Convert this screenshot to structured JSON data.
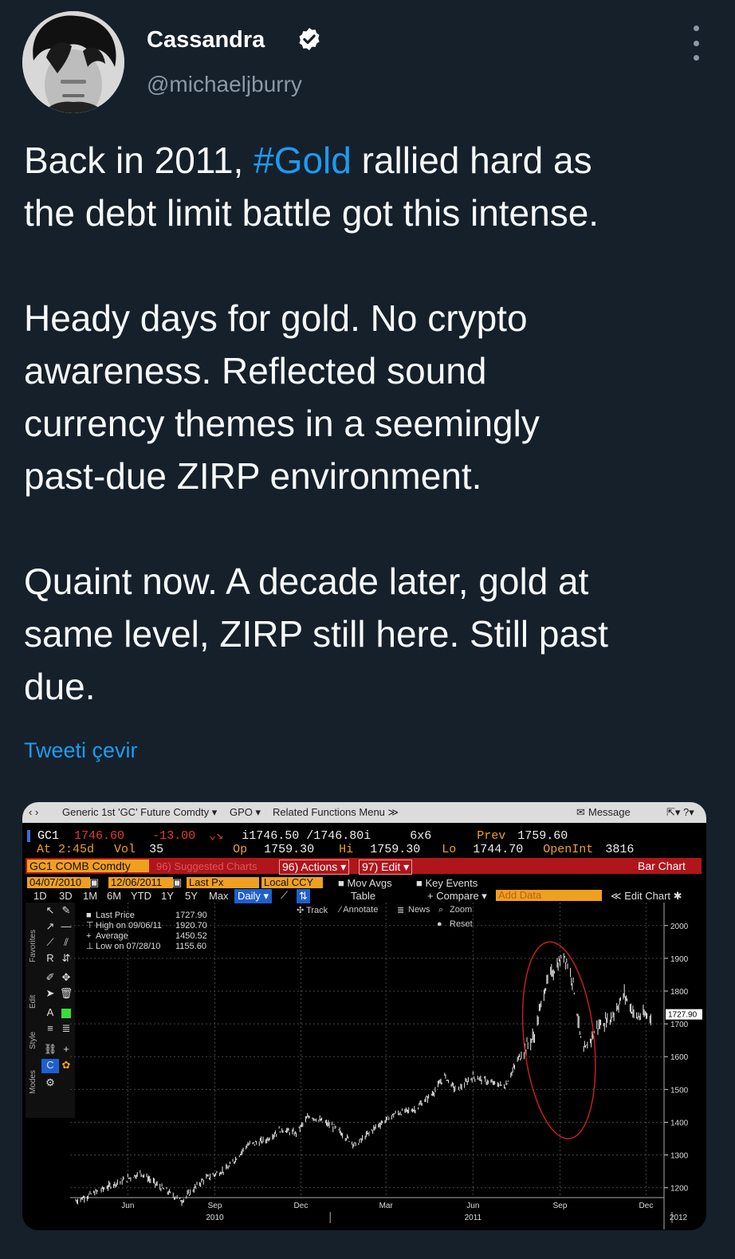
{
  "author": {
    "name": "Cassandra",
    "handle": "@michaeljburry",
    "verified": true,
    "avatar": "avatar-photo"
  },
  "more_icon": "more-vertical-icon",
  "tweet": {
    "para1_before": "Back in 2011, ",
    "hashtag": "#Gold",
    "para1_after": " rallied hard as\nthe debt limit battle got this intense.",
    "para2": "Heady days for gold. No crypto\nawareness. Reflected sound\ncurrency themes in a seemingly\npast-due ZIRP environment.",
    "para3": "Quaint now. A decade later, gold at\nsame level, ZIRP still here. Still past\ndue."
  },
  "translate_link": "Tweeti çevir",
  "colors": {
    "background": "#15202b",
    "link": "#1d9bf0",
    "secondary": "#8b98a5",
    "bloomberg_orange": "#f0a020",
    "bloomberg_red": "#b0151b"
  },
  "terminal": {
    "menubar": {
      "nav": "‹  ›",
      "generic": "Generic 1st 'GC' Future Comdty ▾",
      "gpo": "GPO ▾",
      "related": "Related Functions Menu ≫",
      "message": "Message",
      "right_icons": "⇱▾ ?▾"
    },
    "quote": {
      "ticker": "GC1",
      "last": "1746.60",
      "change": "-13.00",
      "bidask": "i1746.50 /1746.80i",
      "size": "6x6",
      "prev_label": "Prev",
      "prev": "1759.60",
      "at": "At 2:45d",
      "vol_label": "Vol",
      "vol": "35",
      "op_label": "Op",
      "op": "1759.30",
      "hi_label": "Hi",
      "hi": "1759.30",
      "lo_label": "Lo",
      "lo": "1744.70",
      "oi_label": "OpenInt",
      "oi": "3816"
    },
    "security": "GC1 COMB Comdty",
    "suggested": "96) Suggested Charts",
    "actions": "96) Actions ▾",
    "edit": "97) Edit ▾",
    "chart_type": "Bar Chart",
    "date_from": "04/07/2010",
    "date_to": "12/06/2011",
    "field": "Last Px",
    "currency": "Local CCY",
    "mov_avgs": "Mov Avgs",
    "key_events": "Key Events",
    "add_data": "Add Data",
    "periods": [
      "1D",
      "3D",
      "1M",
      "6M",
      "YTD",
      "1Y",
      "5Y",
      "Max"
    ],
    "frequency": "Daily ▾",
    "table": "Table",
    "compare": "+ Compare ▾",
    "edit_chart": "≪  Edit Chart  ✱",
    "chart_tools": {
      "track": "✣ Track",
      "annotate": "⁄ Annotate",
      "news": "News",
      "zoom": "Zoom",
      "reset": "Reset"
    },
    "side_tabs": [
      "Favorites",
      "Edit",
      "Style",
      "Modes"
    ]
  },
  "chart_data": {
    "type": "bar",
    "title": "",
    "legend": [
      {
        "label": "Last Price",
        "value": "1727.90"
      },
      {
        "label": "High on 09/06/11",
        "value": "1920.70"
      },
      {
        "label": "Average",
        "value": "1450.52"
      },
      {
        "label": "Low on 07/28/10",
        "value": "1155.60"
      }
    ],
    "ylim": [
      1170,
      2070
    ],
    "y_ticks": [
      1200,
      1300,
      1400,
      1500,
      1600,
      1700,
      1800,
      1900,
      2000
    ],
    "last_price_tag": "1727.90",
    "x_ticks": [
      "Jun",
      "Sep",
      "Dec",
      "Mar",
      "Jun",
      "Sep",
      "Dec"
    ],
    "x_year_labels": [
      "2010",
      "2011",
      "2012"
    ],
    "grid": true,
    "annotation": "circle-around-2011-peak",
    "x": [
      "2010-04-07",
      "2010-05-01",
      "2010-05-20",
      "2010-06-15",
      "2010-07-01",
      "2010-07-28",
      "2010-08-20",
      "2010-09-15",
      "2010-10-05",
      "2010-10-25",
      "2010-11-10",
      "2010-11-25",
      "2010-12-10",
      "2011-01-05",
      "2011-01-28",
      "2011-02-20",
      "2011-03-10",
      "2011-04-01",
      "2011-04-20",
      "2011-05-02",
      "2011-05-15",
      "2011-06-01",
      "2011-06-20",
      "2011-07-05",
      "2011-07-20",
      "2011-08-05",
      "2011-08-15",
      "2011-08-22",
      "2011-09-06",
      "2011-09-15",
      "2011-09-23",
      "2011-09-26",
      "2011-10-10",
      "2011-10-25",
      "2011-11-08",
      "2011-11-20",
      "2011-12-06"
    ],
    "values": [
      1160,
      1190,
      1215,
      1245,
      1210,
      1160,
      1225,
      1260,
      1330,
      1345,
      1380,
      1365,
      1420,
      1385,
      1330,
      1390,
      1425,
      1440,
      1490,
      1540,
      1495,
      1540,
      1520,
      1510,
      1600,
      1665,
      1800,
      1850,
      1910,
      1825,
      1650,
      1610,
      1690,
      1720,
      1790,
      1720,
      1728
    ]
  }
}
